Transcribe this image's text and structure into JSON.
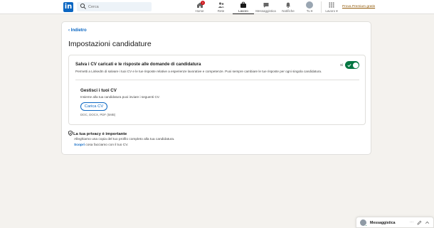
{
  "nav": {
    "logo": "in",
    "search_placeholder": "Cerca",
    "items": [
      {
        "label": "Home",
        "icon": "home-icon",
        "badge": "1"
      },
      {
        "label": "Rete",
        "icon": "network-icon"
      },
      {
        "label": "Lavoro",
        "icon": "jobs-icon",
        "active": true
      },
      {
        "label": "Messaggistica",
        "icon": "messaging-icon"
      },
      {
        "label": "Notifiche",
        "icon": "bell-icon"
      },
      {
        "label": "Tu ▾",
        "icon": "avatar"
      },
      {
        "label": "Lavoro ▾",
        "icon": "grid-icon"
      }
    ],
    "premium": "Prova Premium gratis"
  },
  "page": {
    "back": "Indietro",
    "title": "Impostazioni candidature",
    "save_section": {
      "title": "Salva i CV caricati e le risposte alle domande di candidatura",
      "description": "Permetti a LinkedIn di salvare i tuoi CV e le tue risposte relative a esperienze lavorative e competenze. Puoi sempre cambiare le tue risposte per ogni singola candidatura.",
      "toggle_state": "Sì",
      "toggle_on": true
    },
    "cv_section": {
      "title": "Gestisci i tuoi CV",
      "description": "Insieme alla tua candidatura puoi inviare i seguenti CV.",
      "upload_button": "Carica CV",
      "formats": "DOC, DOCX, PDF (5MB)"
    },
    "privacy": {
      "title": "La tua privacy è importante",
      "text": "Alleghiamo una copia del tuo profilo completo alla tua candidatura.",
      "link": "Scopri",
      "link_suffix": " cosa facciamo con il tuo CV."
    }
  },
  "messaging": {
    "label": "Messaggistica",
    "more": "···"
  },
  "colors": {
    "brand": "#0a66c2",
    "toggle_on": "#057642",
    "premium": "#915907"
  }
}
